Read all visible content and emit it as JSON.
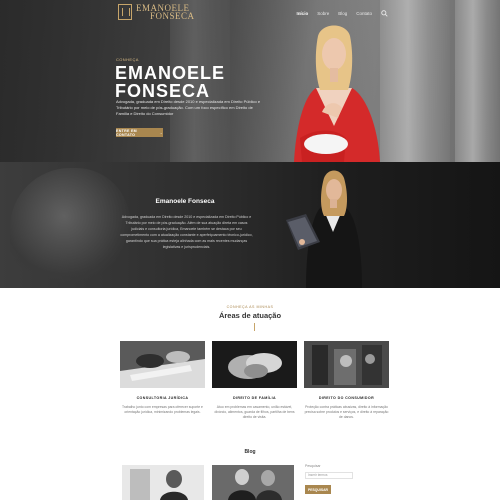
{
  "brand": {
    "line1": "EMANOELE",
    "line2": "FONSECA",
    "accent": "#a9874f"
  },
  "nav": {
    "items": [
      {
        "label": "Início",
        "active": true
      },
      {
        "label": "Sobre",
        "active": false
      },
      {
        "label": "Blog",
        "active": false
      },
      {
        "label": "Contato",
        "active": false
      }
    ],
    "search_icon": "search-icon"
  },
  "hero": {
    "eyebrow": "CONHEÇA",
    "name_line1": "EMANOELE",
    "name_line2": "FONSECA",
    "description": "Advogada, graduada em Direito desde 2010 e especializada em Direito Público e Tributário por meio de pós-graduação. Com um foco específico em Direito de Família e Direito do Consumidor",
    "button_label": "ENTRE EM CONTATO",
    "button_icon": "arrow-right-icon"
  },
  "about": {
    "title": "Emanoele Fonseca",
    "text": "Advogada, graduada em Direito desde 2010 e especializada em Direito Público e Tributário por meio de pós-graduação. Além de sua atuação direta em casos judiciais e consultoria jurídica, Emanoele também se destaca por seu comprometimento com a atualização constante e aperfeiçoamento técnico-jurídico, garantindo que sua prática esteja alinhada com as mais recentes mudanças legislativas e jurisprudenciais."
  },
  "areas": {
    "eyebrow": "CONHEÇA AS MINHAS",
    "title": "Áreas de atuação",
    "cards": [
      {
        "title": "CONSULTORIA JURÍDICA",
        "text": "Trabalho junto com empresas para oferecer suporte e orientação jurídica, minimizando problemas legais."
      },
      {
        "title": "DIREITO DE FAMÍLIA",
        "text": "Atuo em problemas em casamento, união estável, divórcio, alimentos, guarda de filhos, partilha de bens direito de visita."
      },
      {
        "title": "DIREITO DO CONSUMIDOR",
        "text": "Proteção contra práticas abusivas, direito à informação precisa sobre produtos e serviços, e direito à reparação de danos."
      }
    ]
  },
  "blog": {
    "title": "Blog",
    "sidebar_label": "Pesquisar",
    "search_placeholder": "Inserir termos",
    "search_button": "PESQUISAR"
  }
}
